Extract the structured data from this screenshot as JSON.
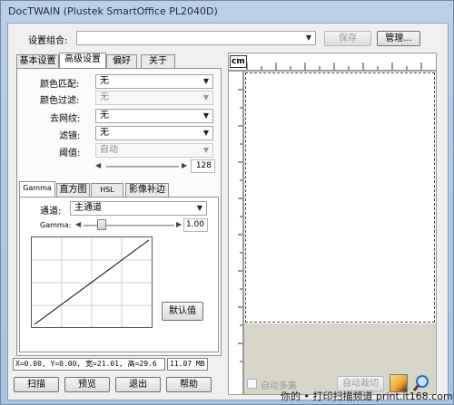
{
  "window": {
    "title": "DocTWAIN (Plustek SmartOffice PL2040D)"
  },
  "top": {
    "preset_label": "设置组合:",
    "preset_value": "",
    "save_label": "保存",
    "manage_label": "管理..."
  },
  "main_tabs": [
    {
      "label": "基本设置"
    },
    {
      "label": "高级设置"
    },
    {
      "label": "偏好"
    },
    {
      "label": "关于"
    }
  ],
  "advanced": {
    "color_match": {
      "label": "颜色匹配:",
      "value": "无"
    },
    "color_filter": {
      "label": "颜色过滤:",
      "value": "无"
    },
    "descreen": {
      "label": "去网纹:",
      "value": "无"
    },
    "filter": {
      "label": "滤镜:",
      "value": "无"
    },
    "threshold": {
      "label": "阈值:",
      "value": "自动",
      "number": "128"
    }
  },
  "sub_tabs": [
    {
      "label": "Gamma"
    },
    {
      "label": "直方图"
    },
    {
      "label": "HSL"
    },
    {
      "label": "影像补边"
    }
  ],
  "gamma": {
    "channel_label": "通道:",
    "channel_value": "主通道",
    "gamma_label": "Gamma:",
    "gamma_value": "1.00",
    "gamma_level": 0.2,
    "default_label": "默认值"
  },
  "ruler": {
    "unit": "cm"
  },
  "status": {
    "coords": "X=0.00, Y=0.00, 宽=21.01, 高=29.6",
    "size": "11.07 MB"
  },
  "bottom_buttons": {
    "scan": "扫描",
    "preview": "预览",
    "exit": "退出",
    "help": "帮助"
  },
  "right_bottom": {
    "auto_stitch": "自动多集",
    "auto_crop": "自动裁切"
  },
  "watermark": "你的 • 打印扫描频道  print.it168.com"
}
